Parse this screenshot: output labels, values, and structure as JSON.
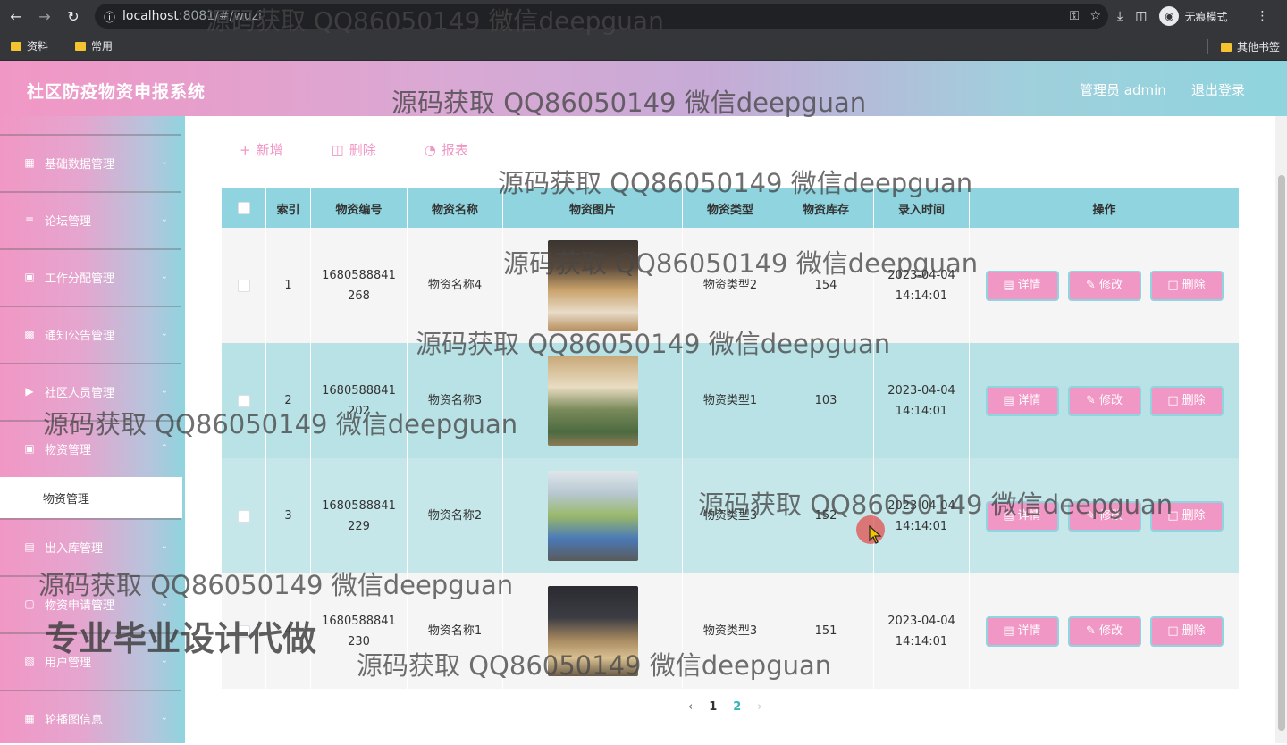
{
  "browser": {
    "url_host": "localhost",
    "url_path": ":8081/#/wuzi",
    "incognito_label": "无痕模式",
    "bookmarks": [
      "资料",
      "常用"
    ],
    "other_bookmarks": "其他书签"
  },
  "header": {
    "title": "社区防疫物资申报系统",
    "admin_label": "管理员 admin",
    "logout": "退出登录"
  },
  "sidebar": {
    "items": [
      {
        "label": "基础数据管理",
        "icon": "grid-icon"
      },
      {
        "label": "论坛管理",
        "icon": "sliders-icon"
      },
      {
        "label": "工作分配管理",
        "icon": "monitor-icon"
      },
      {
        "label": "通知公告管理",
        "icon": "bar-chart-icon"
      },
      {
        "label": "社区人员管理",
        "icon": "video-icon"
      },
      {
        "label": "物资管理",
        "icon": "picture-icon"
      },
      {
        "label": "出入库管理",
        "icon": "document-icon"
      },
      {
        "label": "物资申请管理",
        "icon": "folder-icon"
      },
      {
        "label": "用户管理",
        "icon": "user-icon"
      },
      {
        "label": "轮播图信息",
        "icon": "grid-icon"
      }
    ],
    "active_sub": "物资管理"
  },
  "toolbar": {
    "add": "新增",
    "delete": "删除",
    "report": "报表"
  },
  "table": {
    "headers": [
      "索引",
      "物资编号",
      "物资名称",
      "物资图片",
      "物资类型",
      "物资库存",
      "录入时间",
      "操作"
    ],
    "rows": [
      {
        "index": "1",
        "code_a": "1680588841",
        "code_b": "268",
        "name": "物资名称4",
        "type": "物资类型2",
        "stock": "154",
        "date": "2023-04-04",
        "time": "14:14:01"
      },
      {
        "index": "2",
        "code_a": "1680588841",
        "code_b": "202",
        "name": "物资名称3",
        "type": "物资类型1",
        "stock": "103",
        "date": "2023-04-04",
        "time": "14:14:01"
      },
      {
        "index": "3",
        "code_a": "1680588841",
        "code_b": "229",
        "name": "物资名称2",
        "type": "物资类型3",
        "stock": "152",
        "date": "2023-04-04",
        "time": "14:14:01"
      },
      {
        "index": "4",
        "code_a": "1680588841",
        "code_b": "230",
        "name": "物资名称1",
        "type": "物资类型3",
        "stock": "151",
        "date": "2023-04-04",
        "time": "14:14:01"
      }
    ],
    "actions": {
      "detail": "详情",
      "edit": "修改",
      "delete": "删除"
    }
  },
  "pagination": {
    "pages": [
      "1",
      "2"
    ],
    "current": "2"
  },
  "watermarks": {
    "text": "源码获取 QQ86050149 微信deepguan",
    "big": "专业毕业设计代做"
  },
  "colors": {
    "pink": "#f197c5",
    "teal": "#8fd4de"
  }
}
